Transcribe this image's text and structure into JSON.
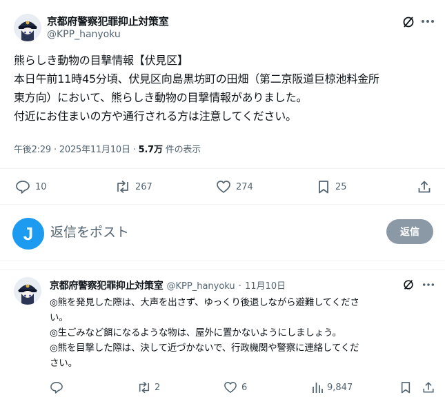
{
  "post": {
    "author_name": "京都府警察犯罪抑止対策室",
    "author_handle": "@KPP_hanyoku",
    "text_lines": [
      "熊らしき動物の目撃情報【伏見区】",
      "本日午前11時45分頃、伏見区向島黒坊町の田畑（第二京阪道巨椋池料金所",
      "東方向）において、熊らしき動物の目撃情報がありました。",
      "付近にお住まいの方や通行される方は注意してください。"
    ],
    "time": "午後2:29",
    "date": "2025年11月10日",
    "views": "5.7万",
    "views_suffix": "件の表示",
    "sep": "·",
    "replies": "10",
    "reposts": "267",
    "likes": "274",
    "bookmarks": "25"
  },
  "reply_box": {
    "avatar_letter": "J",
    "placeholder": "返信をポスト",
    "button": "返信"
  },
  "reply": {
    "author_name": "京都府警察犯罪抑止対策室",
    "author_handle": "@KPP_hanyoku",
    "sep": "·",
    "date": "11月10日",
    "text_lines": [
      "◎熊を発見した際は、大声を出さず、ゆっくり後退しながら避難してくださ",
      "い。",
      "◎生ごみなど餌になるような物は、屋外に置かないようにしましょう。",
      "◎熊を目撃した際は、決して近づかないで、行政機関や警察に連絡してくだ",
      "さい。"
    ],
    "replies": "",
    "reposts": "2",
    "likes": "6",
    "views": "9,847"
  },
  "icons": {
    "reply": "speech-bubble-icon",
    "repost": "repost-arrows-icon",
    "like": "heart-icon",
    "bookmark": "bookmark-icon",
    "share": "share-upload-icon",
    "grok": "grok-icon",
    "more": "more-dots-icon",
    "views": "analytics-bars-icon"
  },
  "colors": {
    "text": "#0f1419",
    "secondary": "#536471",
    "accent": "#1d9bf0",
    "reply_button": "#8b98a5"
  }
}
